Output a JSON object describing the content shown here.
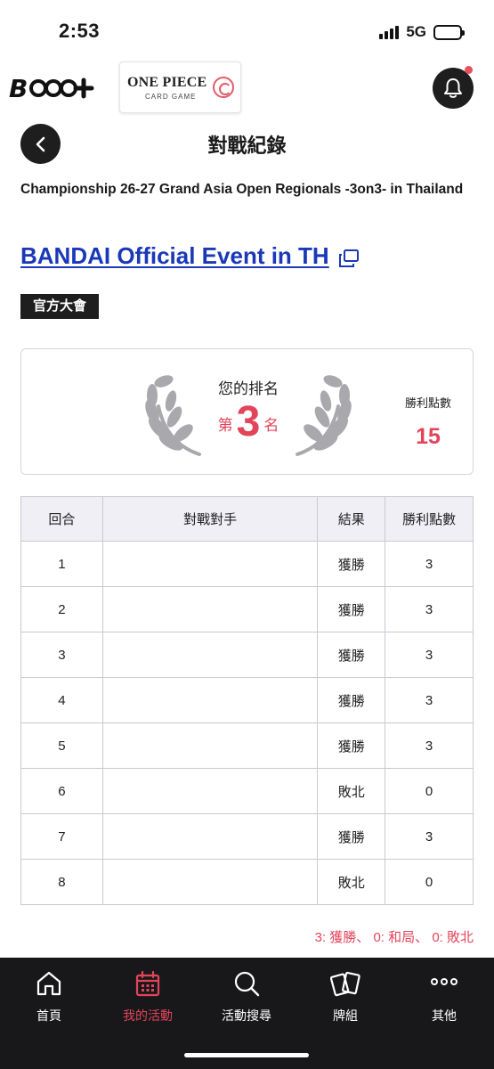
{
  "status_bar": {
    "time": "2:53",
    "network": "5G"
  },
  "header": {
    "brand_logo": "B",
    "game_logo_title": "ONE PIECE",
    "game_logo_sub": "CARD GAME"
  },
  "page": {
    "title": "對戰紀錄",
    "event_name": "Championship 26-27 Grand Asia Open Regionals -3on3- in Thailand",
    "event_link": "BANDAI Official Event in TH",
    "badge": "官方大會"
  },
  "rank_card": {
    "rank_label": "您的排名",
    "rank_prefix": "第",
    "rank_value": "3",
    "rank_suffix": "名",
    "points_label": "勝利點數",
    "points_value": "15"
  },
  "table": {
    "headers": [
      "回合",
      "對戰對手",
      "結果",
      "勝利點數"
    ],
    "rows": [
      {
        "round": "1",
        "opponent": "",
        "result": "獲勝",
        "points": "3"
      },
      {
        "round": "2",
        "opponent": "",
        "result": "獲勝",
        "points": "3"
      },
      {
        "round": "3",
        "opponent": "",
        "result": "獲勝",
        "points": "3"
      },
      {
        "round": "4",
        "opponent": "",
        "result": "獲勝",
        "points": "3"
      },
      {
        "round": "5",
        "opponent": "",
        "result": "獲勝",
        "points": "3"
      },
      {
        "round": "6",
        "opponent": "",
        "result": "敗北",
        "points": "0"
      },
      {
        "round": "7",
        "opponent": "",
        "result": "獲勝",
        "points": "3"
      },
      {
        "round": "8",
        "opponent": "",
        "result": "敗北",
        "points": "0"
      }
    ]
  },
  "legend": "3: 獲勝、 0: 和局、 0: 敗北",
  "bottom_nav": {
    "items": [
      {
        "label": "首頁",
        "icon": "home-icon"
      },
      {
        "label": "我的活動",
        "icon": "calendar-icon",
        "active": true
      },
      {
        "label": "活動搜尋",
        "icon": "search-icon"
      },
      {
        "label": "牌組",
        "icon": "cards-icon"
      },
      {
        "label": "其他",
        "icon": "more-icon"
      }
    ]
  },
  "colors": {
    "accent": "#e2445a",
    "link": "#1a38b8",
    "dark": "#1e1e1e"
  }
}
